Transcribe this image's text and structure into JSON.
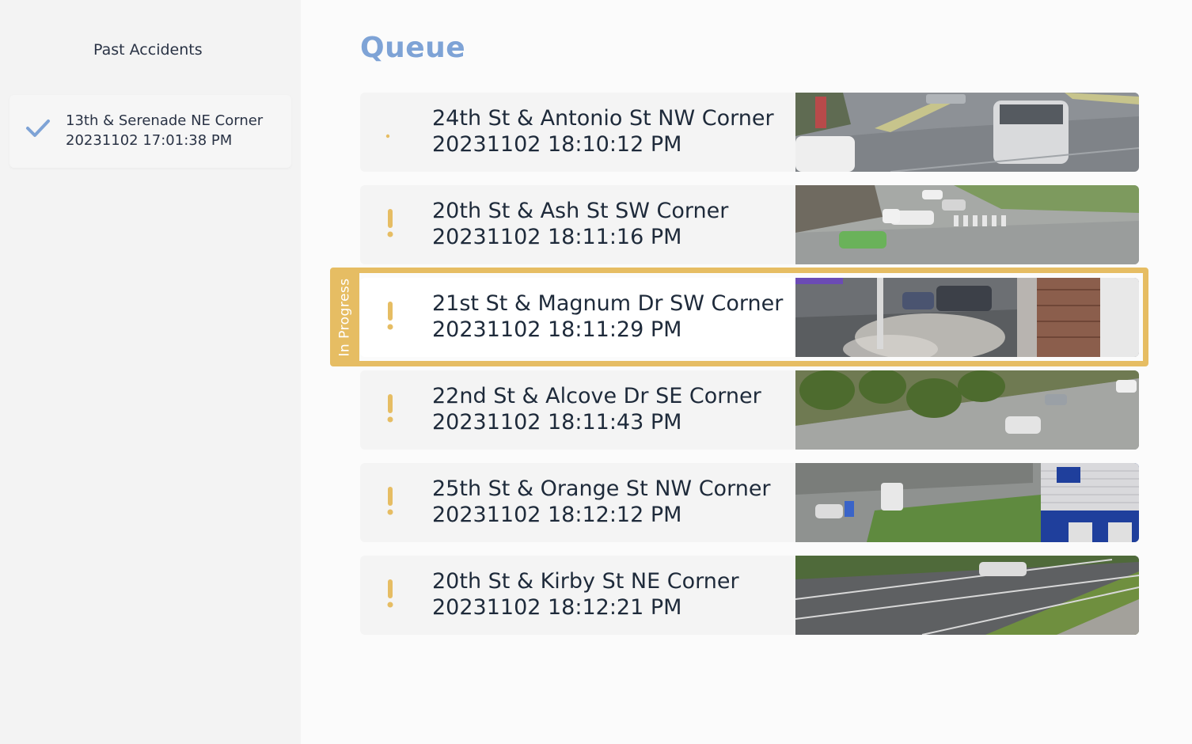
{
  "sidebar": {
    "title": "Past Accidents",
    "items": [
      {
        "location": "13th & Serenade NE Corner",
        "time": "20231102 17:01:38 PM",
        "status_icon": "check-icon"
      }
    ]
  },
  "queue": {
    "title": "Queue",
    "in_progress_label": "In Progress",
    "items": [
      {
        "location": "24th St & Antonio St NW Corner",
        "time": "20231102 18:10:12 PM",
        "status_icon": "dot-icon"
      },
      {
        "location": "20th St & Ash St SW Corner",
        "time": "20231102 18:11:16 PM",
        "status_icon": "alert-icon"
      },
      {
        "location": "21st St & Magnum Dr SW Corner",
        "time": "20231102 18:11:29 PM",
        "status_icon": "alert-icon",
        "in_progress": true
      },
      {
        "location": "22nd St & Alcove Dr SE Corner",
        "time": "20231102 18:11:43 PM",
        "status_icon": "alert-icon"
      },
      {
        "location": "25th St & Orange St NW Corner",
        "time": "20231102 18:12:12 PM",
        "status_icon": "alert-icon"
      },
      {
        "location": "20th St & Kirby St NE Corner",
        "time": "20231102 18:12:21 PM",
        "status_icon": "alert-icon"
      }
    ]
  },
  "colors": {
    "accent_blue": "#7ea3d6",
    "alert_yellow": "#e6bd63",
    "text_dark": "#1e2a3a",
    "sidebar_bg": "#f3f3f3"
  }
}
